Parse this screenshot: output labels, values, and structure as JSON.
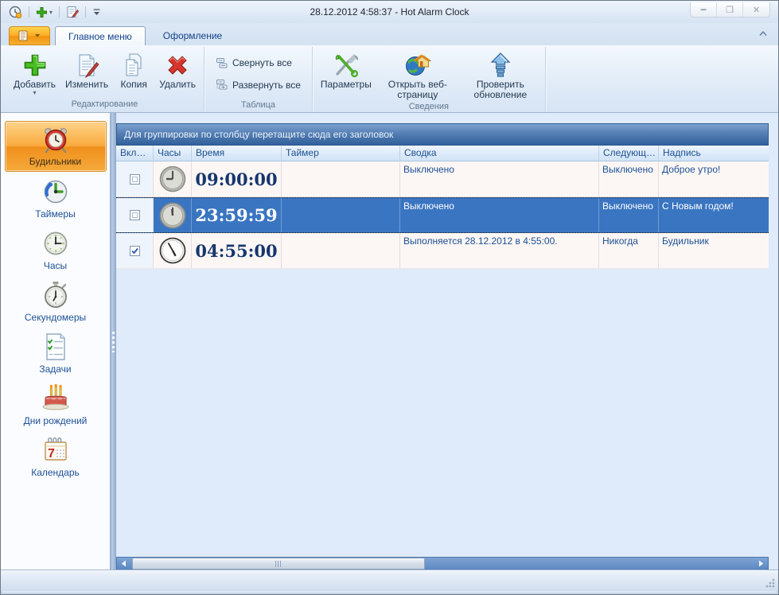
{
  "window": {
    "title": "28.12.2012 4:58:37 - Hot Alarm Clock"
  },
  "tabs": [
    {
      "label": "Главное меню",
      "active": true
    },
    {
      "label": "Оформление",
      "active": false
    }
  ],
  "ribbon": {
    "groups": [
      {
        "label": "Редактирование",
        "buttons": [
          {
            "label": "Добавить",
            "icon": "add-icon",
            "has_dropdown": true
          },
          {
            "label": "Изменить",
            "icon": "edit-icon"
          },
          {
            "label": "Копия",
            "icon": "copy-icon"
          },
          {
            "label": "Удалить",
            "icon": "delete-icon"
          }
        ]
      },
      {
        "label": "Таблица",
        "buttons": [
          {
            "label": "Свернуть все",
            "icon": "collapse-all-icon"
          },
          {
            "label": "Развернуть все",
            "icon": "expand-all-icon"
          }
        ]
      },
      {
        "label": "Сведения",
        "buttons": [
          {
            "label": "Параметры",
            "icon": "tools-icon"
          },
          {
            "label": "Открыть веб-страницу",
            "icon": "web-page-icon"
          },
          {
            "label": "Проверить обновление",
            "icon": "check-update-icon"
          }
        ]
      }
    ]
  },
  "sidebar": {
    "items": [
      {
        "label": "Будильники",
        "icon": "alarm-clock-icon",
        "selected": true
      },
      {
        "label": "Таймеры",
        "icon": "timer-icon",
        "selected": false
      },
      {
        "label": "Часы",
        "icon": "clock-icon",
        "selected": false
      },
      {
        "label": "Секундомеры",
        "icon": "stopwatch-icon",
        "selected": false
      },
      {
        "label": "Задачи",
        "icon": "tasks-icon",
        "selected": false
      },
      {
        "label": "Дни рождений",
        "icon": "birthday-cake-icon",
        "selected": false
      },
      {
        "label": "Календарь",
        "icon": "calendar-icon",
        "selected": false
      }
    ]
  },
  "table": {
    "group_hint": "Для группировки по столбцу перетащите сюда его заголовок",
    "columns": [
      "Вклю...",
      "Часы",
      "Время",
      "Таймер",
      "Сводка",
      "Следующий...",
      "Надпись"
    ],
    "rows": [
      {
        "enabled": false,
        "selected": false,
        "time": "09:00:00",
        "timer": "",
        "summary": "Выключено",
        "next": "Выключено",
        "caption": "Доброе утро!"
      },
      {
        "enabled": false,
        "selected": true,
        "time": "23:59:59",
        "timer": "",
        "summary": "Выключено",
        "next": "Выключено",
        "caption": "С Новым годом!"
      },
      {
        "enabled": true,
        "selected": false,
        "time": "04:55:00",
        "timer": "",
        "summary": "Выполняется 28.12.2012 в 4:55:00.",
        "next": "Никогда",
        "caption": "Будильник"
      }
    ]
  },
  "colors": {
    "selection_blue": "#3a75c1",
    "highlight_orange": "#f29a1f",
    "group_band_blue": "#31609b",
    "accent_text_blue": "#1c4f93",
    "time_text_navy": "#17366e"
  }
}
